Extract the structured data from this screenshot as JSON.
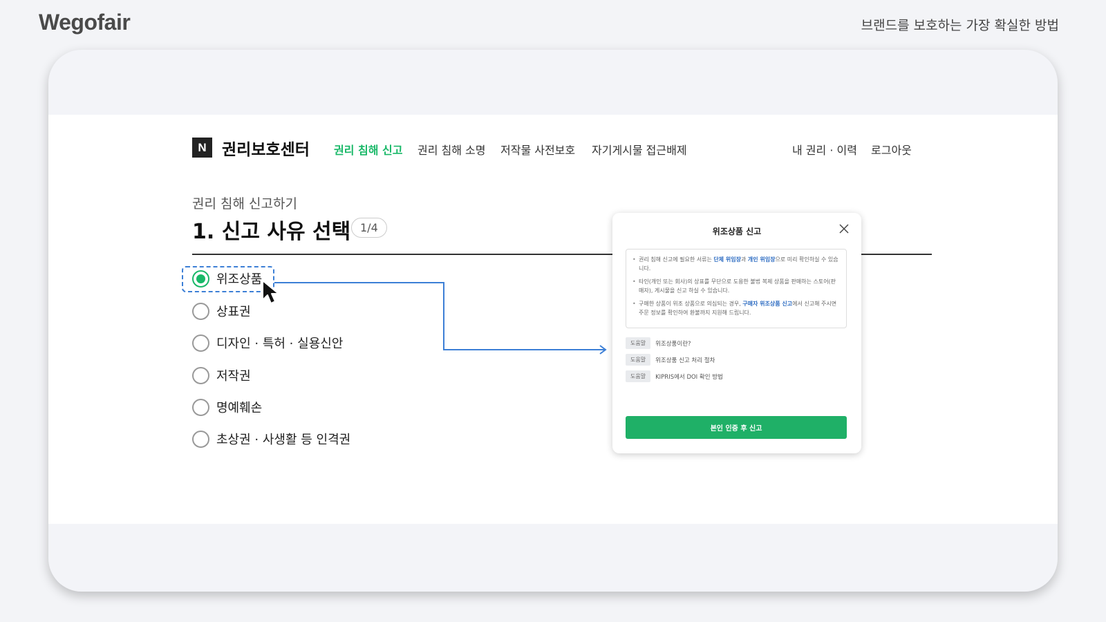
{
  "header": {
    "brand": "Wegofair",
    "tagline": "브랜드를 보호하는 가장 확실한 방법"
  },
  "site": {
    "logo_letter": "N",
    "title": "권리보호센터",
    "nav": [
      "권리 침해 신고",
      "권리 침해 소명",
      "저작물 사전보호",
      "자기게시물 접근배제"
    ],
    "nav_active_index": 0,
    "user_links": [
      "내 권리 · 이력",
      "로그아웃"
    ]
  },
  "page": {
    "subtitle": "권리 침해 신고하기",
    "title": "1. 신고 사유 선택",
    "step": "1/4"
  },
  "options": [
    {
      "label": "위조상품",
      "selected": true
    },
    {
      "label": "상표권",
      "selected": false
    },
    {
      "label": "디자인 · 특허 · 실용신안",
      "selected": false
    },
    {
      "label": "저작권",
      "selected": false
    },
    {
      "label": "명예훼손",
      "selected": false
    },
    {
      "label": "초상권 · 사생활 등 인격권",
      "selected": false
    }
  ],
  "modal": {
    "title": "위조상품 신고",
    "info": {
      "item1": {
        "pre": "권리 침해 신고에 필요한 서류는 ",
        "hl1": "단체 위임장",
        "mid": "과 ",
        "hl2": "개인 위임장",
        "post": "으로 미리 확인하실 수 있습니다."
      },
      "item2": "타인(개인 또는 회사)의 상표를 무단으로 도용한 불법 복제 상품을 판매하는 스토어(판매자), 게시물을 신고 하실 수 있습니다.",
      "item3": {
        "pre": "구매한 상품이 위조 상품으로 의심되는 경우, ",
        "hl": "구매자 위조상품 신고",
        "post": "에서 신고해 주시면 주문 정보를 확인하여 환불까지 지원해 드립니다."
      }
    },
    "help_tag": "도움말",
    "help_links": [
      "위조상품이란?",
      "위조상품 신고 처리 절차",
      "KIPRIS에서 DOI 확인 방법"
    ],
    "confirm_button": "본인 인증 후 신고"
  },
  "colors": {
    "accent_green": "#19b868",
    "highlight_blue": "#3c7fd6",
    "button_green": "#1fb067"
  }
}
